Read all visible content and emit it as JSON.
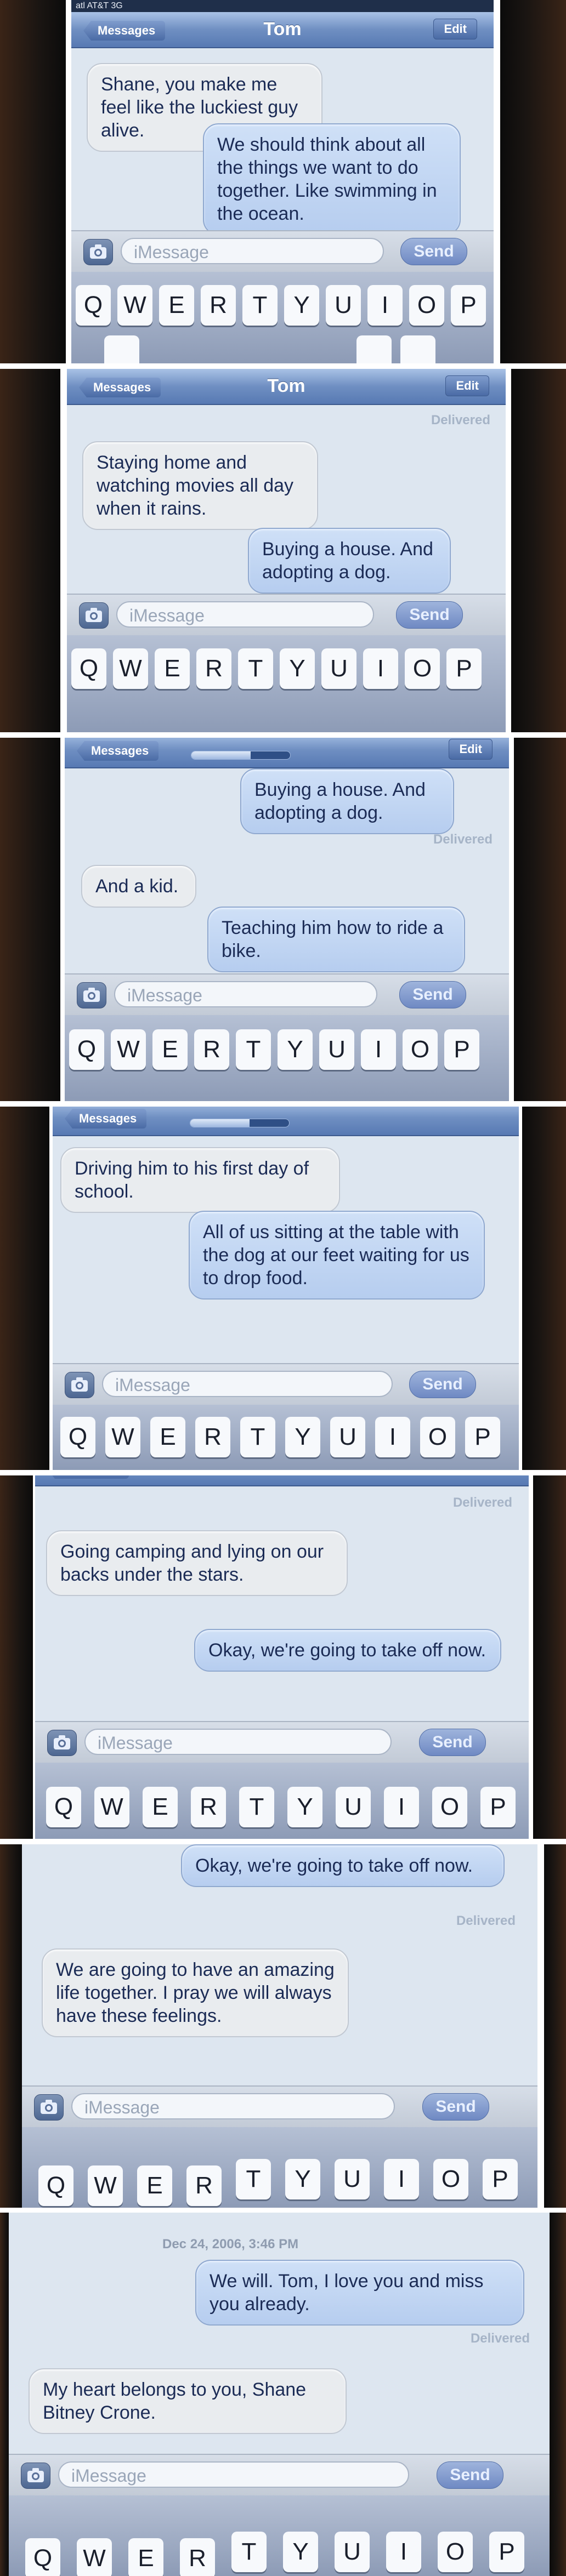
{
  "status": {
    "carrier": "atl AT&T 3G"
  },
  "nav": {
    "back_label": "Messages",
    "title": "Tom",
    "edit_label": "Edit",
    "progress": 0.6
  },
  "labels": {
    "delivered": "Delivered",
    "timestamp": "Dec 24, 2006, 3:46 PM"
  },
  "input": {
    "placeholder": "iMessage",
    "send_label": "Send"
  },
  "keyboard": {
    "row1": [
      "Q",
      "W",
      "E",
      "R",
      "T",
      "Y",
      "U",
      "I",
      "O",
      "P"
    ]
  },
  "panels": [
    {
      "messages": [
        {
          "from": "them",
          "text": "Shane, you make me feel like the luckiest guy alive."
        },
        {
          "from": "me",
          "text": "We should think about all the things we want to do together. Like swimming in the ocean."
        }
      ]
    },
    {
      "messages": [
        {
          "from": "them",
          "text": "Staying home and watching movies all day when it rains."
        },
        {
          "from": "me",
          "text": "Buying a house. And adopting a dog."
        }
      ]
    },
    {
      "messages": [
        {
          "from": "me",
          "text": "Buying a house. And adopting a dog."
        },
        {
          "from": "them",
          "text": "And a kid."
        },
        {
          "from": "me",
          "text": "Teaching him how to ride a bike."
        }
      ]
    },
    {
      "messages": [
        {
          "from": "them",
          "text": "Driving him to his first day of school."
        },
        {
          "from": "me",
          "text": "All of us sitting at the table with the dog at our feet waiting for us to drop food."
        }
      ]
    },
    {
      "messages": [
        {
          "from": "them",
          "text": "Going camping and lying on our backs under the stars."
        },
        {
          "from": "me",
          "text": "Okay, we're going to take off now."
        }
      ]
    },
    {
      "messages": [
        {
          "from": "me",
          "text": "Okay, we're going to take off now."
        },
        {
          "from": "them",
          "text": "We are going to have an amazing life together. I pray we will always have these feelings."
        }
      ]
    },
    {
      "messages": [
        {
          "from": "me",
          "text": "We will. Tom, I love you and miss you already."
        },
        {
          "from": "them",
          "text": "My heart belongs to you, Shane Bitney Crone."
        }
      ]
    }
  ]
}
